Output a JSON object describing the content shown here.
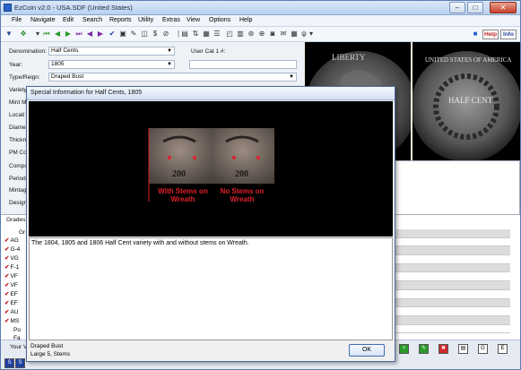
{
  "window": {
    "title": "EzCoin v2.0 - USA.SDF (United States)",
    "min": "–",
    "max": "□",
    "close": "✕"
  },
  "menu": [
    "File",
    "Navigate",
    "Edit",
    "Search",
    "Reports",
    "Utility",
    "Extras",
    "View",
    "Options",
    "Help"
  ],
  "toolbar": {
    "help_label": "Help",
    "info_label": "Info"
  },
  "form": {
    "denomination_label": "Denomination:",
    "denomination_value": "Half Cents",
    "year_label": "Year:",
    "year_value": "1805",
    "type_label": "Type/Reign:",
    "type_value": "Draped Bust",
    "usercat_label": "User Cat 1 #:",
    "partial_labels": [
      "Variety",
      "Mint Ma",
      "Locati",
      "Diame",
      "Thickn",
      "PM Cou",
      "Compo",
      "Period:",
      "Mintage",
      "Design"
    ]
  },
  "grades": {
    "header_label": "Grades",
    "column_header": "Gr",
    "rows": [
      "AG",
      "G-4",
      "VG",
      "F-1",
      "VF",
      "VF",
      "EF",
      "EF",
      "AU",
      "MS",
      "Po",
      "Fa"
    ],
    "your_label": "Your V"
  },
  "dialog": {
    "title": "Special Information for Half Cents, 1805",
    "label_with": "With Stems on Wreath",
    "label_without": "No Stems on Wreath",
    "description": "The 1804, 1805 and 1806 Half Cent variety with and without stems on Wreath.",
    "footer_line1": "Draped Bust",
    "footer_line2": "Large 5, Stems",
    "ok_label": "OK"
  },
  "coin_reverse_text": {
    "legend": "UNITED STATES OF AMERICA",
    "center": "HALF CENT"
  },
  "coin_obverse_text": {
    "legend": "LIBERTY"
  },
  "colors": {
    "accent": "#e0202a",
    "check": "#c0191e"
  }
}
